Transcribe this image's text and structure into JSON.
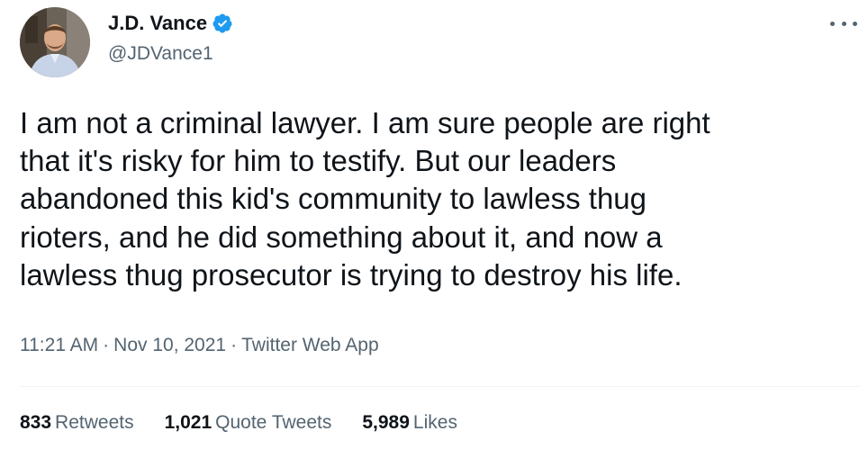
{
  "author": {
    "display_name": "J.D. Vance",
    "handle": "@JDVance1",
    "verified": true,
    "avatar_icon": "avatar-photo"
  },
  "tweet": {
    "text": "I am not a criminal lawyer. I am sure people are right\nthat it's risky for him to testify. But our leaders\nabandoned this kid's community to lawless thug\nrioters, and he did something about it, and now a\nlawless thug prosecutor is trying to destroy his life.",
    "time": "11:21 AM",
    "date": "Nov 10, 2021",
    "source": "Twitter Web App",
    "separator": "·"
  },
  "stats": {
    "retweets_count": "833",
    "retweets_label": "Retweets",
    "quotes_count": "1,021",
    "quotes_label": "Quote Tweets",
    "likes_count": "5,989",
    "likes_label": "Likes"
  },
  "colors": {
    "text_primary": "#0f1419",
    "text_secondary": "#536471",
    "verified_blue": "#1d9bf0",
    "divider": "#eff3f4"
  },
  "icons": {
    "verified": "verified-badge-icon",
    "more": "more-options-icon"
  }
}
